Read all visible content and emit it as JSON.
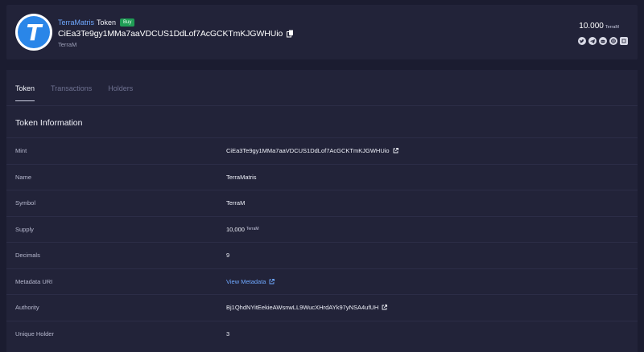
{
  "header": {
    "token_name": "TerraMatris",
    "token_type": "Token",
    "buy_label": "Buy",
    "address": "CiEa3Te9gy1MMa7aaVDCUS1DdLof7AcGCKTmKJGWHUio",
    "symbol": "TerraM",
    "logo_letter": "T",
    "supply_value": "10.000",
    "supply_unit": "TerraM",
    "socials": [
      "twitter-icon",
      "telegram-icon",
      "discord-icon",
      "website-icon",
      "copy-link-icon"
    ]
  },
  "tabs": [
    {
      "label": "Token",
      "active": true
    },
    {
      "label": "Transactions",
      "active": false
    },
    {
      "label": "Holders",
      "active": false
    }
  ],
  "section_title": "Token Information",
  "rows": [
    {
      "label": "Mint",
      "value": "CiEa3Te9gy1MMa7aaVDCUS1DdLof7AcGCKTmKJGWHUio"
    },
    {
      "label": "Name",
      "value": "TerraMatris"
    },
    {
      "label": "Symbol",
      "value": "TerraM"
    },
    {
      "label": "Supply",
      "value": "10,000",
      "unit": "TerraM"
    },
    {
      "label": "Decimals",
      "value": "9"
    },
    {
      "label": "Metadata URI",
      "value": "View Metadata"
    },
    {
      "label": "Authority",
      "value": "Bj1QhdNYitEekieAWsnwLL9WucXHrdAYk97yNSA4ufUH"
    },
    {
      "label": "Unique Holder",
      "value": "3"
    }
  ],
  "colors": {
    "background": "#1b1c30",
    "panel": "#222339",
    "link": "#6fa8ff",
    "buy_badge": "#1f9d55",
    "logo": "#2a86e8"
  }
}
